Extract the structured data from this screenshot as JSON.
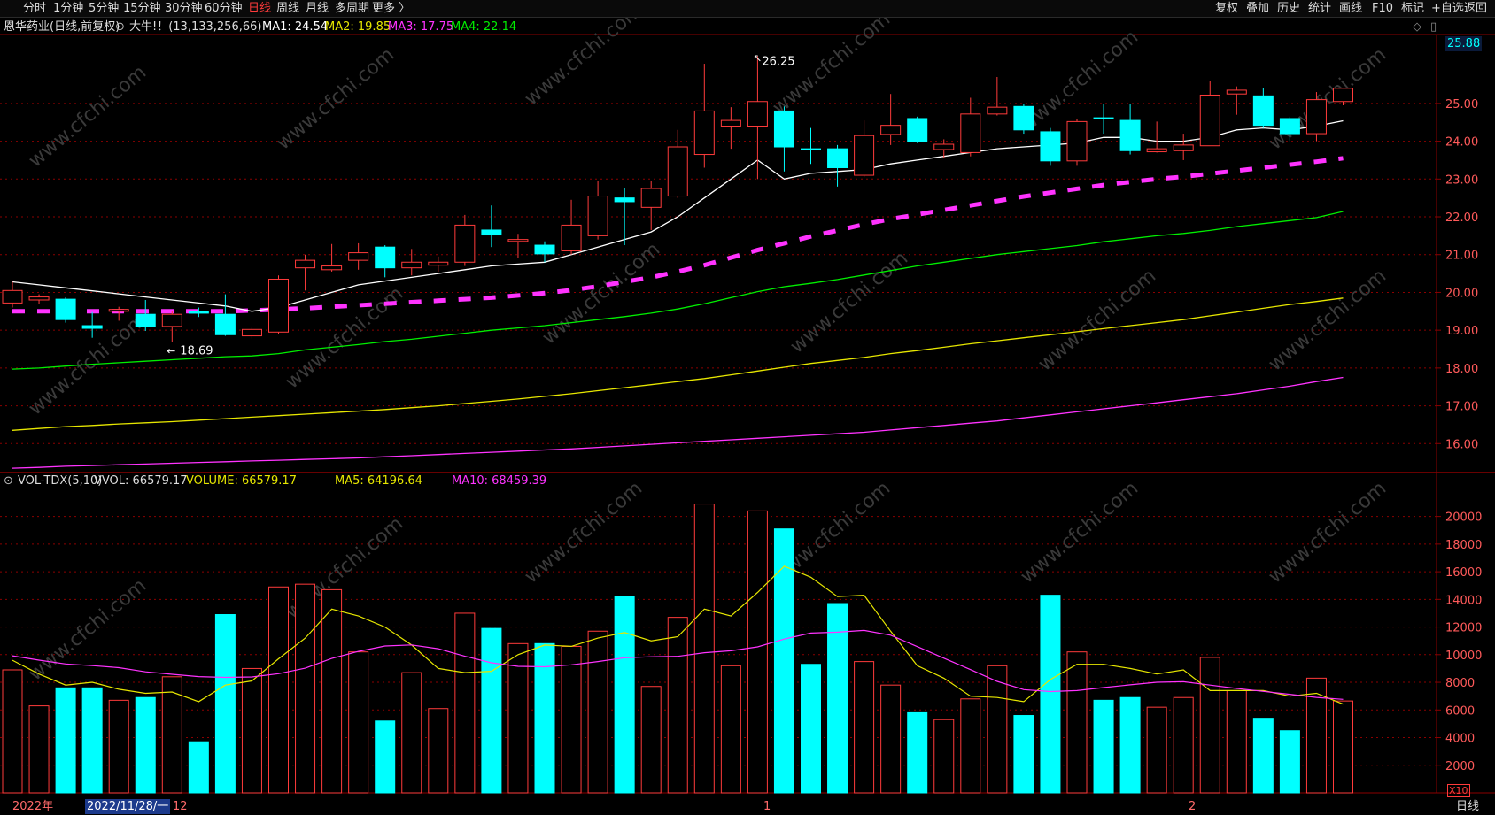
{
  "toolbar": {
    "left_items": [
      "分时",
      "1分钟",
      "5分钟",
      "15分钟",
      "30分钟",
      "60分钟",
      "日线",
      "周线",
      "月线",
      "多周期",
      "更多 〉"
    ],
    "active_index": 6,
    "right_items": [
      "复权",
      "叠加",
      "历史",
      "统计",
      "画线",
      "F10",
      "标记",
      "+自选",
      "返回"
    ]
  },
  "price_panel": {
    "stock_name": "恩华药业(日线,前复权)",
    "indicator_name": "大牛!！(13,133,256,66)",
    "ma1_label": "MA1: 24.54",
    "ma2_label": "MA2: 19.85",
    "ma3_label": "MA3: 17.75",
    "ma4_label": "MA4: 22.14",
    "high_annotation": "26.25",
    "low_annotation": "18.69",
    "current_price_tag": "25.88",
    "axis_ticks": [
      "25.00",
      "24.00",
      "23.00",
      "22.00",
      "21.00",
      "20.00",
      "19.00",
      "18.00",
      "17.00",
      "16.00"
    ]
  },
  "volume_panel": {
    "label_name": "VOL-TDX(5,10)",
    "vvol_label": "VVOL: 66579.17",
    "volume_label": "VOLUME: 66579.17",
    "ma5_label": "MA5: 64196.64",
    "ma10_label": "MA10: 68459.39",
    "multiplier_label": "X10",
    "axis_ticks": [
      "20000",
      "18000",
      "16000",
      "14000",
      "12000",
      "10000",
      "8000",
      "6000",
      "4000",
      "2000"
    ]
  },
  "bottom_bar": {
    "year_label": "2022年",
    "cursor_date": "2022/11/28/一",
    "month_labels": [
      "12",
      "1",
      "2"
    ],
    "period_label": "日线"
  },
  "colors": {
    "up": "#ff3b3b",
    "down": "#00ffff",
    "ma1": "#ffffff",
    "ma2": "#e6e600",
    "ma3": "#ff33ff",
    "ma4": "#00ee00",
    "grid": "#8b0000"
  },
  "chart_data": [
    {
      "type": "candlestick",
      "title": "恩华药业(日线,前复权)",
      "ylim": [
        15.0,
        26.8
      ],
      "candles": [
        {
          "o": 19.72,
          "c": 20.05,
          "h": 20.28,
          "l": 19.6
        },
        {
          "o": 19.8,
          "c": 19.88,
          "h": 19.95,
          "l": 19.7
        },
        {
          "o": 19.82,
          "c": 19.28,
          "h": 19.87,
          "l": 19.2
        },
        {
          "o": 19.12,
          "c": 19.05,
          "h": 19.48,
          "l": 18.8
        },
        {
          "o": 19.5,
          "c": 19.55,
          "h": 19.62,
          "l": 19.25
        },
        {
          "o": 19.42,
          "c": 19.1,
          "h": 19.8,
          "l": 18.98
        },
        {
          "o": 19.1,
          "c": 19.42,
          "h": 19.5,
          "l": 18.69
        },
        {
          "o": 19.5,
          "c": 19.45,
          "h": 19.6,
          "l": 19.35
        },
        {
          "o": 19.42,
          "c": 18.88,
          "h": 19.95,
          "l": 18.85
        },
        {
          "o": 18.85,
          "c": 19.02,
          "h": 19.1,
          "l": 18.78
        },
        {
          "o": 18.95,
          "c": 20.35,
          "h": 20.45,
          "l": 18.9
        },
        {
          "o": 20.65,
          "c": 20.85,
          "h": 21.0,
          "l": 20.05
        },
        {
          "o": 20.6,
          "c": 20.7,
          "h": 21.28,
          "l": 20.55
        },
        {
          "o": 20.85,
          "c": 21.05,
          "h": 21.3,
          "l": 20.6
        },
        {
          "o": 21.2,
          "c": 20.65,
          "h": 21.25,
          "l": 20.4
        },
        {
          "o": 20.65,
          "c": 20.8,
          "h": 21.15,
          "l": 20.45
        },
        {
          "o": 20.72,
          "c": 20.8,
          "h": 20.95,
          "l": 20.55
        },
        {
          "o": 20.8,
          "c": 21.78,
          "h": 22.05,
          "l": 20.7
        },
        {
          "o": 21.65,
          "c": 21.52,
          "h": 22.3,
          "l": 21.2
        },
        {
          "o": 21.35,
          "c": 21.4,
          "h": 21.55,
          "l": 20.9
        },
        {
          "o": 21.25,
          "c": 21.02,
          "h": 21.35,
          "l": 20.8
        },
        {
          "o": 21.1,
          "c": 21.78,
          "h": 22.45,
          "l": 21.0
        },
        {
          "o": 21.5,
          "c": 22.55,
          "h": 22.95,
          "l": 21.4
        },
        {
          "o": 22.5,
          "c": 22.4,
          "h": 22.75,
          "l": 21.25
        },
        {
          "o": 22.25,
          "c": 22.75,
          "h": 22.95,
          "l": 21.65
        },
        {
          "o": 22.55,
          "c": 23.85,
          "h": 24.3,
          "l": 22.5
        },
        {
          "o": 23.65,
          "c": 24.8,
          "h": 26.05,
          "l": 23.3
        },
        {
          "o": 24.4,
          "c": 24.55,
          "h": 24.9,
          "l": 23.8
        },
        {
          "o": 24.4,
          "c": 25.05,
          "h": 26.25,
          "l": 23.0
        },
        {
          "o": 24.8,
          "c": 23.85,
          "h": 24.92,
          "l": 23.2
        },
        {
          "o": 23.8,
          "c": 23.78,
          "h": 24.35,
          "l": 23.4
        },
        {
          "o": 23.8,
          "c": 23.3,
          "h": 23.9,
          "l": 22.8
        },
        {
          "o": 23.1,
          "c": 24.15,
          "h": 24.55,
          "l": 23.05
        },
        {
          "o": 24.18,
          "c": 24.42,
          "h": 25.25,
          "l": 23.9
        },
        {
          "o": 24.6,
          "c": 24.0,
          "h": 24.65,
          "l": 23.95
        },
        {
          "o": 23.78,
          "c": 23.92,
          "h": 24.05,
          "l": 23.55
        },
        {
          "o": 23.7,
          "c": 24.72,
          "h": 25.15,
          "l": 23.6
        },
        {
          "o": 24.72,
          "c": 24.9,
          "h": 25.7,
          "l": 24.68
        },
        {
          "o": 24.92,
          "c": 24.3,
          "h": 24.98,
          "l": 24.2
        },
        {
          "o": 24.25,
          "c": 23.48,
          "h": 24.35,
          "l": 23.35
        },
        {
          "o": 23.48,
          "c": 24.52,
          "h": 24.6,
          "l": 23.35
        },
        {
          "o": 24.62,
          "c": 24.6,
          "h": 24.98,
          "l": 24.2
        },
        {
          "o": 24.55,
          "c": 23.75,
          "h": 24.98,
          "l": 23.65
        },
        {
          "o": 23.72,
          "c": 23.8,
          "h": 24.52,
          "l": 23.7
        },
        {
          "o": 23.75,
          "c": 23.9,
          "h": 24.2,
          "l": 23.5
        },
        {
          "o": 23.88,
          "c": 25.22,
          "h": 25.6,
          "l": 23.95
        },
        {
          "o": 25.25,
          "c": 25.35,
          "h": 25.45,
          "l": 24.7
        },
        {
          "o": 25.2,
          "c": 24.42,
          "h": 25.4,
          "l": 24.35
        },
        {
          "o": 24.6,
          "c": 24.2,
          "h": 24.65,
          "l": 24.0
        },
        {
          "o": 24.2,
          "c": 25.1,
          "h": 25.3,
          "l": 24.0
        },
        {
          "o": 25.05,
          "c": 25.4,
          "h": 25.4,
          "l": 24.95
        }
      ],
      "ma1": [
        20.28,
        20.2,
        20.12,
        20.04,
        19.96,
        19.88,
        19.8,
        19.72,
        19.64,
        19.5,
        19.6,
        19.8,
        20.0,
        20.2,
        20.3,
        20.4,
        20.5,
        20.6,
        20.7,
        20.75,
        20.8,
        21.0,
        21.2,
        21.4,
        21.6,
        22.0,
        22.5,
        23.0,
        23.5,
        23.0,
        23.15,
        23.2,
        23.25,
        23.4,
        23.5,
        23.6,
        23.7,
        23.8,
        23.85,
        23.9,
        23.95,
        24.1,
        24.1,
        24.0,
        24.0,
        24.1,
        24.3,
        24.35,
        24.3,
        24.4,
        24.54
      ],
      "ma2": [
        16.35,
        16.4,
        16.45,
        16.48,
        16.52,
        16.55,
        16.58,
        16.62,
        16.66,
        16.7,
        16.74,
        16.78,
        16.82,
        16.86,
        16.9,
        16.95,
        17.0,
        17.06,
        17.12,
        17.18,
        17.25,
        17.32,
        17.4,
        17.48,
        17.56,
        17.64,
        17.72,
        17.82,
        17.92,
        18.02,
        18.12,
        18.2,
        18.28,
        18.38,
        18.46,
        18.55,
        18.64,
        18.72,
        18.8,
        18.88,
        18.96,
        19.04,
        19.12,
        19.2,
        19.28,
        19.38,
        19.48,
        19.58,
        19.68,
        19.76,
        19.85
      ],
      "ma3": [
        15.35,
        15.37,
        15.4,
        15.42,
        15.44,
        15.46,
        15.48,
        15.5,
        15.52,
        15.54,
        15.56,
        15.58,
        15.6,
        15.62,
        15.65,
        15.68,
        15.71,
        15.74,
        15.77,
        15.8,
        15.83,
        15.86,
        15.9,
        15.94,
        15.98,
        16.02,
        16.06,
        16.1,
        16.14,
        16.18,
        16.22,
        16.26,
        16.3,
        16.36,
        16.42,
        16.48,
        16.54,
        16.6,
        16.68,
        16.76,
        16.84,
        16.92,
        17.0,
        17.08,
        17.16,
        17.24,
        17.32,
        17.42,
        17.52,
        17.64,
        17.75
      ],
      "ma4": [
        19.5,
        19.5,
        19.5,
        19.5,
        19.5,
        19.5,
        19.5,
        19.5,
        19.5,
        19.52,
        19.55,
        19.58,
        19.62,
        19.66,
        19.7,
        19.74,
        19.78,
        19.82,
        19.86,
        19.92,
        19.98,
        20.06,
        20.16,
        20.28,
        20.4,
        20.55,
        20.72,
        20.92,
        21.12,
        21.3,
        21.48,
        21.64,
        21.8,
        21.94,
        22.06,
        22.18,
        22.3,
        22.42,
        22.54,
        22.64,
        22.74,
        22.84,
        22.92,
        23.0,
        23.06,
        23.14,
        23.22,
        23.3,
        23.38,
        23.46,
        23.55
      ],
      "ma_green": [
        17.97,
        18.0,
        18.05,
        18.1,
        18.14,
        18.18,
        18.22,
        18.26,
        18.3,
        18.32,
        18.38,
        18.48,
        18.55,
        18.62,
        18.7,
        18.76,
        18.84,
        18.92,
        19.0,
        19.06,
        19.12,
        19.2,
        19.28,
        19.36,
        19.45,
        19.56,
        19.7,
        19.86,
        20.02,
        20.15,
        20.24,
        20.34,
        20.46,
        20.58,
        20.7,
        20.8,
        20.9,
        21.0,
        21.08,
        21.16,
        21.24,
        21.34,
        21.42,
        21.5,
        21.56,
        21.64,
        21.74,
        21.82,
        21.9,
        21.98,
        22.14
      ]
    },
    {
      "type": "bar",
      "title": "VOL-TDX(5,10)",
      "ylim": [
        0,
        21000
      ],
      "volumes": [
        8900,
        6300,
        7600,
        7600,
        6700,
        6900,
        8400,
        3700,
        12900,
        9000,
        14900,
        15100,
        14700,
        10200,
        5200,
        8700,
        6100,
        13000,
        11900,
        10800,
        10800,
        10600,
        11700,
        14200,
        7700,
        12700,
        20900,
        9200,
        20400,
        19100,
        9300,
        13700,
        9500,
        7800,
        5800,
        5300,
        6800,
        9200,
        5600,
        14300,
        10200,
        6700,
        6900,
        6200,
        6900,
        9800,
        7400,
        5400,
        4500,
        8300,
        6650
      ],
      "vol_ma5": [
        9600,
        8600,
        7800,
        8000,
        7500,
        7200,
        7300,
        6600,
        7800,
        8100,
        9700,
        11200,
        13300,
        12800,
        12000,
        10700,
        9000,
        8700,
        8800,
        10000,
        10700,
        10600,
        11200,
        11600,
        11000,
        11300,
        13300,
        12800,
        14500,
        16400,
        15600,
        14200,
        14300,
        11700,
        9200,
        8300,
        7000,
        6900,
        6600,
        8200,
        9300,
        9300,
        9000,
        8600,
        8900,
        7400,
        7400,
        7400,
        7000,
        7200,
        6419
      ]
    }
  ]
}
